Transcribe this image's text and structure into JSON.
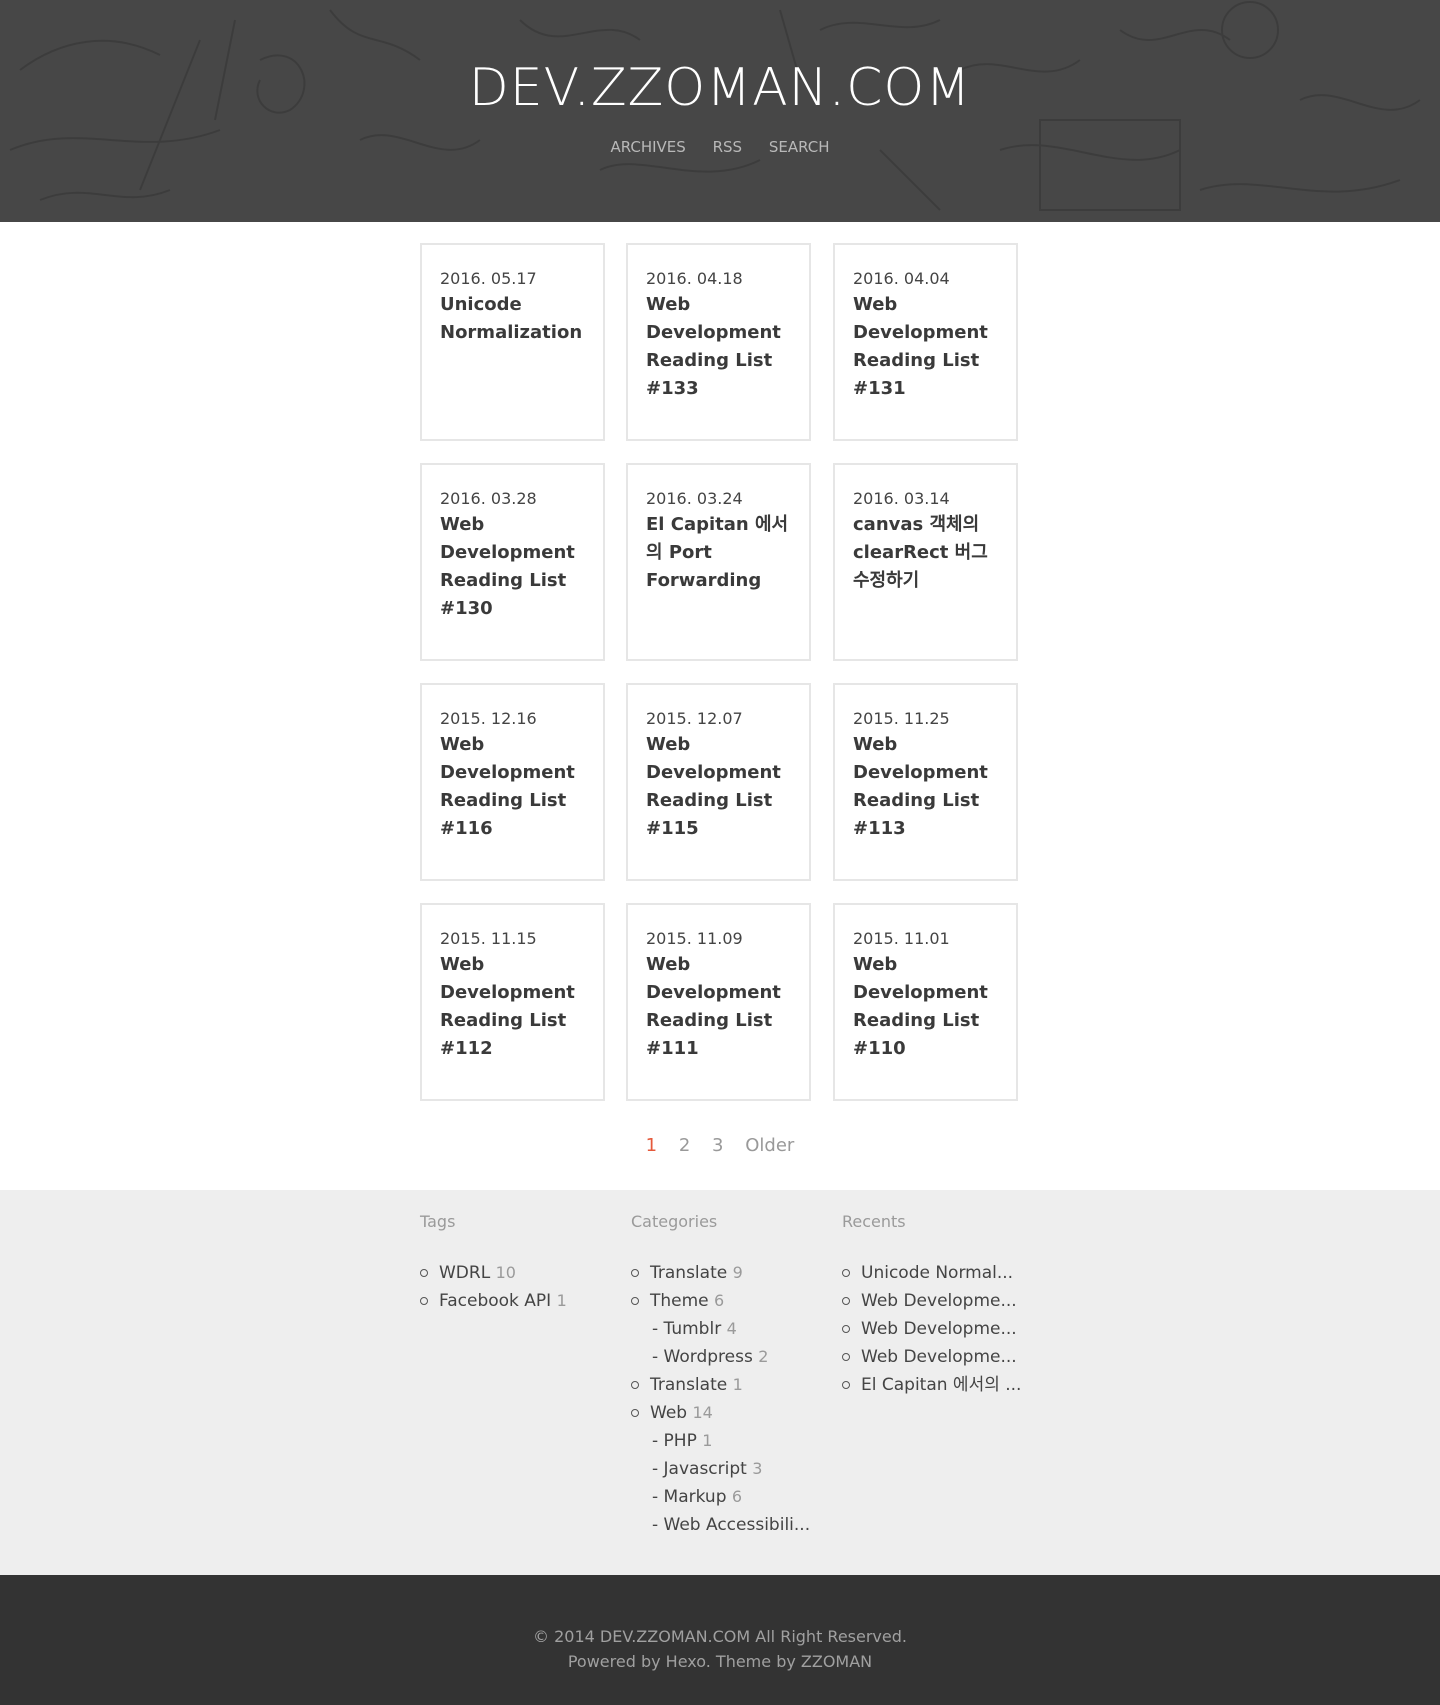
{
  "header": {
    "title": "DEV.ZZOMAN.COM",
    "nav": [
      "ARCHIVES",
      "RSS",
      "SEARCH"
    ]
  },
  "posts": [
    {
      "date": "2016. 05.17",
      "title": "Unicode Normalization"
    },
    {
      "date": "2016. 04.18",
      "title": "Web Development Reading List #133"
    },
    {
      "date": "2016. 04.04",
      "title": "Web Development Reading List #131"
    },
    {
      "date": "2016. 03.28",
      "title": "Web Development Reading List #130"
    },
    {
      "date": "2016. 03.24",
      "title": "El Capitan 에서의 Port Forwarding"
    },
    {
      "date": "2016. 03.14",
      "title": "canvas 객체의 clearRect 버그 수정하기"
    },
    {
      "date": "2015. 12.16",
      "title": "Web Development Reading List #116"
    },
    {
      "date": "2015. 12.07",
      "title": "Web Development Reading List #115"
    },
    {
      "date": "2015. 11.25",
      "title": "Web Development Reading List #113"
    },
    {
      "date": "2015. 11.15",
      "title": "Web Development Reading List #112"
    },
    {
      "date": "2015. 11.09",
      "title": "Web Development Reading List #111"
    },
    {
      "date": "2015. 11.01",
      "title": "Web Development Reading List #110"
    }
  ],
  "pagination": {
    "current": "1",
    "pages": [
      "2",
      "3"
    ],
    "older": "Older"
  },
  "widgets": {
    "tags": {
      "heading": "Tags",
      "items": [
        {
          "label": "WDRL",
          "count": "10"
        },
        {
          "label": "Facebook API",
          "count": "1"
        }
      ]
    },
    "categories": {
      "heading": "Categories",
      "items": [
        {
          "label": "Translate",
          "count": "9"
        },
        {
          "label": "Theme",
          "count": "6"
        },
        {
          "label": "- Tumblr",
          "count": "4"
        },
        {
          "label": "- Wordpress",
          "count": "2"
        },
        {
          "label": "Translate",
          "count": "1"
        },
        {
          "label": "Web",
          "count": "14"
        },
        {
          "label": "- PHP",
          "count": "1"
        },
        {
          "label": "- Javascript",
          "count": "3"
        },
        {
          "label": "- Markup",
          "count": "6"
        },
        {
          "label": "- Web Accessibili...",
          "count": ""
        }
      ]
    },
    "recents": {
      "heading": "Recents",
      "items": [
        "Unicode Normal...",
        "Web Developme...",
        "Web Developme...",
        "Web Developme...",
        "El Capitan 에서의 ..."
      ]
    }
  },
  "footer": {
    "copyright": "© 2014 DEV.ZZOMAN.COM All Right Reserved.",
    "powered": "Powered by Hexo. Theme by ZZOMAN"
  },
  "colors": {
    "header_bg": "#474747",
    "accent": "#e5593b",
    "widgets_bg": "#eeeeee",
    "footer_bg": "#333333"
  }
}
